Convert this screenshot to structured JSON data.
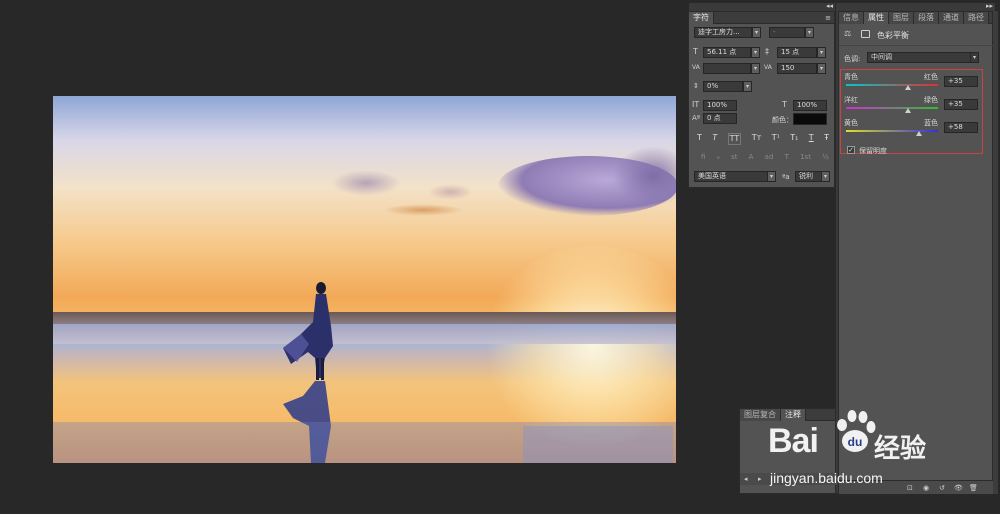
{
  "character_panel": {
    "tab": "字符",
    "font_family": "迪字工房力...",
    "font_style": "-",
    "font_size": "56.11 点",
    "leading": "15 点",
    "kerning": "",
    "tracking": "150",
    "vertical_shift": "0%",
    "vertical_scale": "100%",
    "horizontal_scale": "100%",
    "baseline_shift": "0 点",
    "color_label": "颜色：",
    "type_styles": [
      "T",
      "T",
      "TT",
      "Tт",
      "T¹",
      "T₁",
      "T",
      "Ŧ"
    ],
    "language": "美国英语",
    "aa_label": "ªa",
    "antialias": "锐利"
  },
  "properties_panel": {
    "tabs": [
      "信息",
      "属性",
      "图层",
      "段落",
      "通道",
      "路径"
    ],
    "active_tab": "属性",
    "adjustment_title": "色彩平衡",
    "tone_label": "色调:",
    "tone_value": "中间调",
    "sliders": [
      {
        "left": "青色",
        "right": "红色",
        "value": "+35",
        "position": 0.675
      },
      {
        "left": "洋红",
        "right": "绿色",
        "value": "+35",
        "position": 0.675
      },
      {
        "left": "黄色",
        "right": "蓝色",
        "value": "+58",
        "position": 0.79
      }
    ],
    "preserve_luminosity": "保留明度",
    "preserve_checked": true,
    "accent_color": "#d04040"
  },
  "layer_comps_panel": {
    "tabs": [
      "图层复合",
      "注释"
    ],
    "active_tab": "注释"
  },
  "watermark": {
    "brand": "Bai",
    "brand_tail": "经验",
    "url": "jingyan.baidu.com"
  }
}
